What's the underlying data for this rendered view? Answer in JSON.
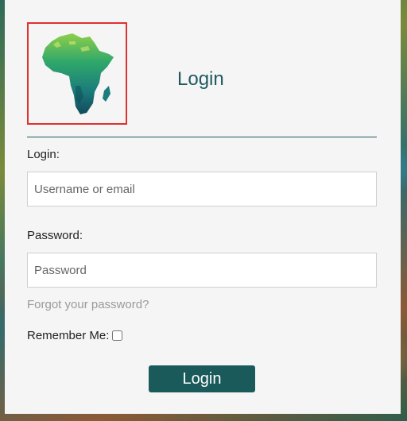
{
  "header": {
    "title": "Login"
  },
  "form": {
    "login_label": "Login:",
    "login_placeholder": "Username or email",
    "login_value": "",
    "password_label": "Password:",
    "password_placeholder": "Password",
    "password_value": "",
    "forgot_link": "Forgot your password?",
    "remember_label": "Remember Me:",
    "remember_checked": false,
    "submit_label": "Login"
  },
  "colors": {
    "accent": "#1b5a5a",
    "title": "#1f5a60",
    "logo_border": "#e03030",
    "link": "#9a9a9a"
  },
  "icons": {
    "logo": "africa-map-logo",
    "remember": "checkbox-icon"
  }
}
